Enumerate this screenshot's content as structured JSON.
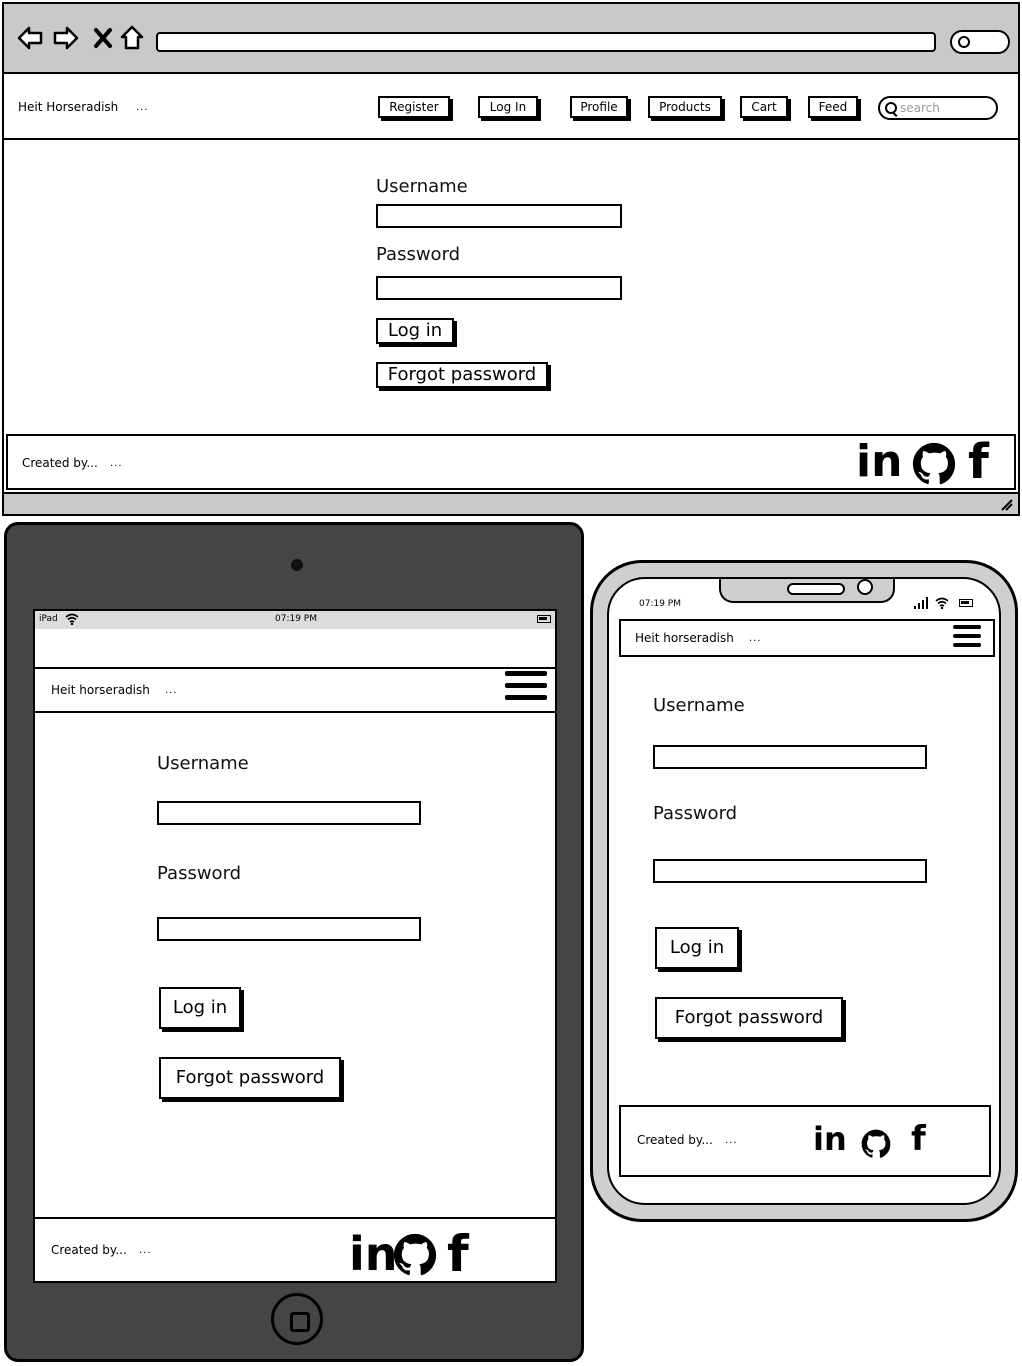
{
  "desktop": {
    "brand": "Heit Horseradish",
    "brand_dots": "...",
    "nav": [
      "Register",
      "Log In",
      "Profile",
      "Products",
      "Cart",
      "Feed"
    ],
    "search_placeholder": "search",
    "username_label": "Username",
    "password_label": "Password",
    "login_button": "Log in",
    "forgot_button": "Forgot password",
    "footer_text": "Created by...",
    "footer_dots": "..."
  },
  "tablet": {
    "status_device": "iPad",
    "status_time": "07:19 PM",
    "brand": "Heit horseradish",
    "brand_dots": "...",
    "username_label": "Username",
    "password_label": "Password",
    "login_button": "Log in",
    "forgot_button": "Forgot password",
    "footer_text": "Created by...",
    "footer_dots": "..."
  },
  "phone": {
    "status_time": "07:19 PM",
    "brand": "Heit horseradish",
    "brand_dots": "...",
    "username_label": "Username",
    "password_label": "Password",
    "login_button": "Log in",
    "forgot_button": "Forgot password",
    "footer_text": "Created by...",
    "footer_dots": "..."
  },
  "social": {
    "linkedin": "in",
    "facebook": "f",
    "icons": [
      "linkedin-icon",
      "github-icon",
      "facebook-icon"
    ]
  }
}
